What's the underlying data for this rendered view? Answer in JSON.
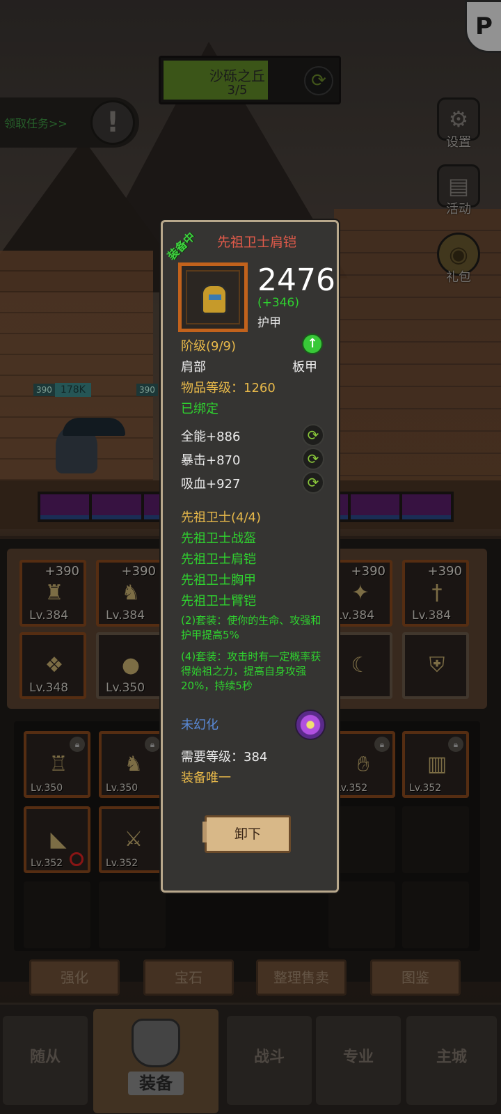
{
  "zone": {
    "name": "沙砾之丘",
    "progress": "3/5",
    "progress_fraction": 0.6
  },
  "quest": {
    "label": "领取任务>>",
    "icon": "exclamation-icon"
  },
  "corner_badge": {
    "glyph": "P"
  },
  "side_buttons": [
    {
      "label": "设置",
      "icon": "gear-icon"
    },
    {
      "label": "活动",
      "icon": "scroll-icon"
    },
    {
      "label": "礼包",
      "icon": "coin-icon"
    }
  ],
  "battle": {
    "hp_tags": [
      {
        "level": "390",
        "value": "178K"
      },
      {
        "level": "390",
        "value": ""
      }
    ]
  },
  "equipment_slots": [
    {
      "plus": "+390",
      "level": "Lv.384"
    },
    {
      "plus": "+390",
      "level": "Lv.384"
    },
    {
      "plus": "+390",
      "level": "Lv.384"
    },
    {
      "plus": "+390",
      "level": "Lv.384"
    },
    {
      "plus": "",
      "level": "Lv.348"
    },
    {
      "plus": "",
      "level": "Lv.350"
    },
    {
      "plus": "",
      "level": ""
    },
    {
      "plus": "",
      "level": ""
    }
  ],
  "bag_slots": [
    {
      "level": "Lv.350"
    },
    {
      "level": "Lv.350"
    },
    {
      "level": "Lv.352"
    },
    {
      "level": "Lv.352"
    },
    {
      "level": "Lv.352"
    },
    {
      "level": "Lv.352"
    }
  ],
  "actions": {
    "enhance": "强化",
    "gem": "宝石",
    "sort_sell": "整理售卖",
    "codex": "图鉴"
  },
  "nav": {
    "followers": "随从",
    "equipment": "装备",
    "battle": "战斗",
    "profession": "专业",
    "main_city": "主城"
  },
  "tooltip": {
    "equipped_tag": "装备中",
    "item_name": "先祖卫士肩铠",
    "armor_value": "2476",
    "armor_delta": "(+346)",
    "armor_label": "护甲",
    "tier": "阶级(9/9)",
    "slot": "肩部",
    "armor_type": "板甲",
    "item_level": "物品等级：1260",
    "bound": "已绑定",
    "stats": [
      {
        "text": "全能+886"
      },
      {
        "text": "暴击+870"
      },
      {
        "text": "吸血+927"
      }
    ],
    "set_name": "先祖卫士(4/4)",
    "set_pieces": [
      "先祖卫士战盔",
      "先祖卫士肩铠",
      "先祖卫士胸甲",
      "先祖卫士臂铠"
    ],
    "set_bonus_2": "(2)套装：使你的生命、攻强和护甲提高5%",
    "set_bonus_4": "(4)套装：攻击时有一定概率获得始祖之力，提高自身攻强20%，持续5秒",
    "transmog": "未幻化",
    "required_level": "需要等级：384",
    "unique": "装备唯一",
    "unequip_label": "卸下"
  },
  "colors": {
    "item_name": "#e05a4a",
    "green_text": "#2fd22f",
    "gold_text": "#e8b94a",
    "blue_text": "#5a8ad8",
    "border_orange": "#c2621c"
  }
}
